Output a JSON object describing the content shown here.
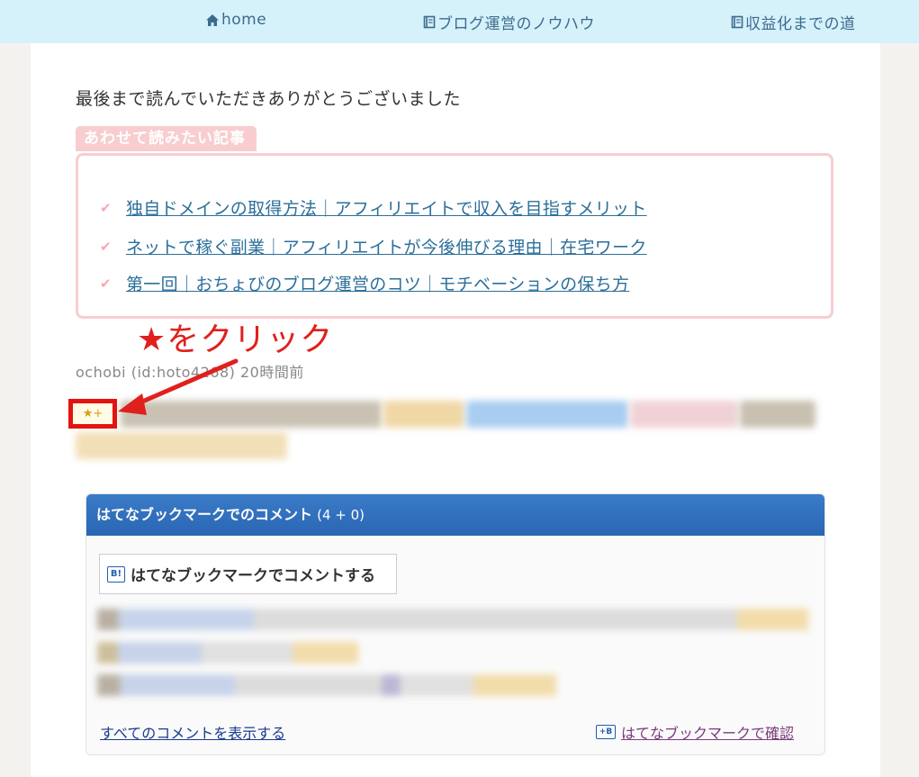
{
  "nav": {
    "items": [
      {
        "label": "home",
        "icon": "home-icon"
      },
      {
        "label": "ブログ運営のノウハウ",
        "icon": "book-icon"
      },
      {
        "label": "収益化までの道",
        "icon": "book-icon"
      }
    ]
  },
  "article": {
    "closing": "最後まで読んでいただきありがとうございました"
  },
  "related": {
    "title": "あわせて読みたい記事",
    "items": [
      "独自ドメインの取得方法｜アフィリエイトで収入を目指すメリット",
      "ネットで稼ぐ副業｜アフィリエイトが今後伸びる理由｜在宅ワーク",
      "第一回｜おちょびのブログ運営のコツ｜モチベーションの保ち方"
    ]
  },
  "annotation": {
    "text": "★をクリック",
    "color": "#e0201c"
  },
  "meta": {
    "author": "ochobi (id:hoto4268) 20時間前"
  },
  "star": {
    "label": "★+"
  },
  "hatena": {
    "title": "はてなブックマークでのコメント",
    "count": "(4 + 0)",
    "comment_button": "はてなブックマークでコメントする",
    "all_comments": "すべてのコメントを表示する",
    "confirm": "はてなブックマークで確認",
    "header_color": "#2f6fbd"
  }
}
